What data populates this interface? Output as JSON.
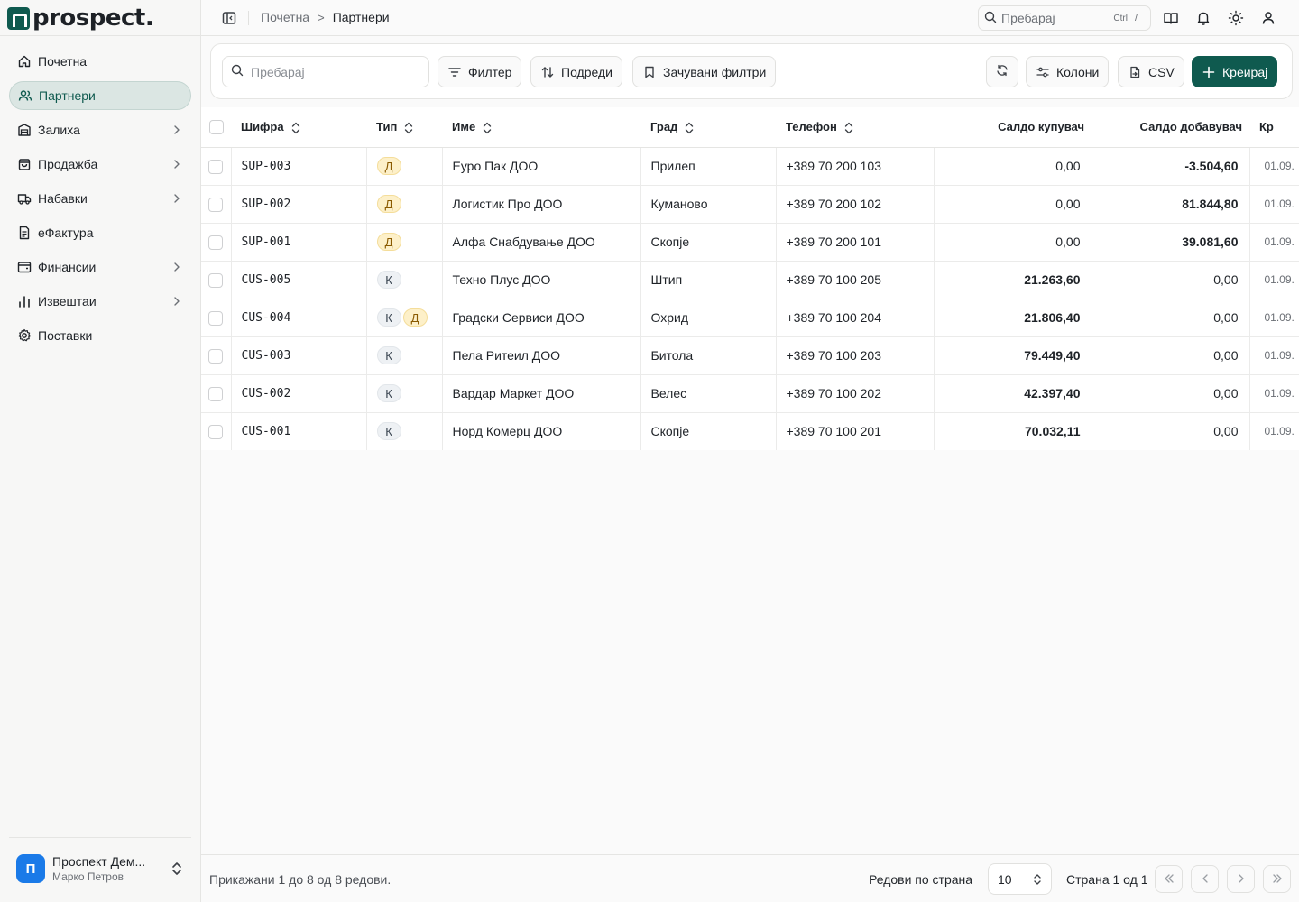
{
  "app": {
    "logo_text": "prospect."
  },
  "sidebar": {
    "items": [
      {
        "label": "Почетна",
        "icon": "home-icon",
        "expandable": false,
        "active": false
      },
      {
        "label": "Партнери",
        "icon": "users-icon",
        "expandable": false,
        "active": true
      },
      {
        "label": "Залиха",
        "icon": "warehouse-icon",
        "expandable": true,
        "active": false
      },
      {
        "label": "Продажба",
        "icon": "shopping-bag-icon",
        "expandable": true,
        "active": false
      },
      {
        "label": "Набавки",
        "icon": "truck-icon",
        "expandable": true,
        "active": false
      },
      {
        "label": "еФактура",
        "icon": "document-icon",
        "expandable": false,
        "active": false
      },
      {
        "label": "Финансии",
        "icon": "wallet-icon",
        "expandable": true,
        "active": false
      },
      {
        "label": "Извештаи",
        "icon": "bar-chart-icon",
        "expandable": true,
        "active": false
      },
      {
        "label": "Поставки",
        "icon": "gear-icon",
        "expandable": false,
        "active": false
      }
    ],
    "org": {
      "avatar_letter": "П",
      "name": "Проспект Дем...",
      "user": "Марко Петров"
    }
  },
  "header": {
    "breadcrumb": {
      "parent": "Почетна",
      "separator": ">",
      "current": "Партнери"
    },
    "search": {
      "placeholder": "Пребарај",
      "shortcut_key": "Ctrl",
      "shortcut_slash": "/"
    }
  },
  "toolbar": {
    "search_placeholder": "Пребарај",
    "filter_label": "Филтер",
    "sort_label": "Подреди",
    "saved_filters_label": "Зачувани филтри",
    "columns_label": "Колони",
    "csv_label": "CSV",
    "create_label": "Креирај"
  },
  "table": {
    "columns": [
      "Шифра",
      "Тип",
      "Име",
      "Град",
      "Телефон",
      "Салдо купувач",
      "Салдо добавувач",
      "Кр"
    ],
    "rows": [
      {
        "code": "SUP-003",
        "types": [
          "Д"
        ],
        "name": "Еуро Пак ДОО",
        "city": "Прилеп",
        "phone": "+389 70 200 103",
        "buyer_balance": "0,00",
        "supplier_balance": "-3.504,60",
        "date": "01.09."
      },
      {
        "code": "SUP-002",
        "types": [
          "Д"
        ],
        "name": "Логистик Про ДОО",
        "city": "Куманово",
        "phone": "+389 70 200 102",
        "buyer_balance": "0,00",
        "supplier_balance": "81.844,80",
        "date": "01.09."
      },
      {
        "code": "SUP-001",
        "types": [
          "Д"
        ],
        "name": "Алфа Снабдување ДОО",
        "city": "Скопје",
        "phone": "+389 70 200 101",
        "buyer_balance": "0,00",
        "supplier_balance": "39.081,60",
        "date": "01.09."
      },
      {
        "code": "CUS-005",
        "types": [
          "К"
        ],
        "name": "Техно Плус ДОО",
        "city": "Штип",
        "phone": "+389 70 100 205",
        "buyer_balance": "21.263,60",
        "supplier_balance": "0,00",
        "date": "01.09."
      },
      {
        "code": "CUS-004",
        "types": [
          "К",
          "Д"
        ],
        "name": "Градски Сервиси ДОО",
        "city": "Охрид",
        "phone": "+389 70 100 204",
        "buyer_balance": "21.806,40",
        "supplier_balance": "0,00",
        "date": "01.09."
      },
      {
        "code": "CUS-003",
        "types": [
          "К"
        ],
        "name": "Пела Ритеил ДОО",
        "city": "Битола",
        "phone": "+389 70 100 203",
        "buyer_balance": "79.449,40",
        "supplier_balance": "0,00",
        "date": "01.09."
      },
      {
        "code": "CUS-002",
        "types": [
          "К"
        ],
        "name": "Вардар Маркет ДОО",
        "city": "Велес",
        "phone": "+389 70 100 202",
        "buyer_balance": "42.397,40",
        "supplier_balance": "0,00",
        "date": "01.09."
      },
      {
        "code": "CUS-001",
        "types": [
          "К"
        ],
        "name": "Норд Комерц ДОО",
        "city": "Скопје",
        "phone": "+389 70 100 201",
        "buyer_balance": "70.032,11",
        "supplier_balance": "0,00",
        "date": "01.09."
      }
    ]
  },
  "footer": {
    "summary": "Прикажани 1 до 8 од 8 редови.",
    "rows_per_page_label": "Редови по страна",
    "rows_per_page_value": "10",
    "page_label": "Страна 1 од 1"
  },
  "colors": {
    "accent": "#0f5a4f",
    "active_nav_bg": "#dbe6e3",
    "badge_d_bg": "#fdf0c9",
    "badge_k_bg": "#eef1f4",
    "org_avatar": "#1a7ae8"
  }
}
